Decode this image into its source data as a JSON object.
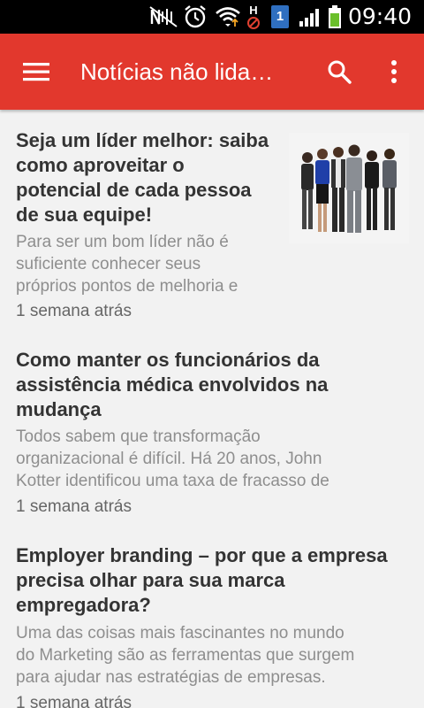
{
  "status_bar": {
    "time": "09:40",
    "notification_badge": "1",
    "network_label": "H",
    "icons": [
      "nfc-icon",
      "alarm-icon",
      "wifi-icon",
      "network-h-icon",
      "notification-badge-icon",
      "signal-icon",
      "battery-icon"
    ]
  },
  "app_bar": {
    "title": "Notícias não lida…",
    "color": "#e2382d",
    "menu_icon": "menu-icon",
    "search_icon": "search-icon",
    "more_icon": "more-vert-icon"
  },
  "articles": [
    {
      "title_lines": [
        "Seja um líder melhor: saiba",
        "como aproveitar o",
        "potencial de cada pessoa",
        "de sua equipe!"
      ],
      "snippet_lines": [
        "Para ser um bom líder não é",
        "suficiente conhecer seus",
        "próprios pontos de melhoria e"
      ],
      "time": "1 semana atrás",
      "has_thumbnail": true
    },
    {
      "title_lines": [
        "Como manter os funcionários da",
        "assistência médica envolvidos na",
        "mudança"
      ],
      "snippet_lines": [
        "Todos sabem que transformação",
        "organizacional é difícil. Há 20 anos, John",
        "Kotter identificou uma taxa de fracasso de"
      ],
      "time": "1 semana atrás",
      "has_thumbnail": false
    },
    {
      "title_lines": [
        "Employer branding – por que a empresa",
        "precisa olhar para sua marca",
        "empregadora?"
      ],
      "snippet_lines": [
        "Uma das coisas mais fascinantes no mundo",
        "do Marketing são as ferramentas que surgem",
        "para ajudar nas estratégias de empresas."
      ],
      "time": "1 semana atrás",
      "has_thumbnail": false
    }
  ]
}
